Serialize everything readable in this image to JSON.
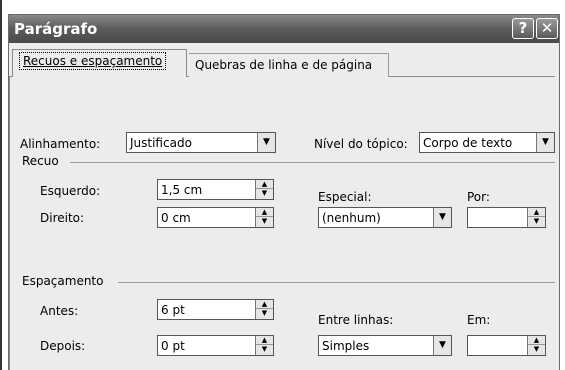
{
  "window": {
    "title": "Parágrafo",
    "help_glyph": "?",
    "close_glyph": "✕"
  },
  "tabs": [
    {
      "label": "Recuos e espaçamento",
      "active": true
    },
    {
      "label": "Quebras de linha e de página",
      "active": false
    }
  ],
  "general": {
    "alignment_label": "Alinhamento:",
    "alignment_value": "Justificado",
    "outline_label": "Nível do tópico:",
    "outline_value": "Corpo de texto"
  },
  "indent": {
    "section_label": "Recuo",
    "left_label": "Esquerdo:",
    "left_value": "1,5 cm",
    "right_label": "Direito:",
    "right_value": "0 cm",
    "special_label": "Especial:",
    "special_value": "(nenhum)",
    "by_label": "Por:",
    "by_value": ""
  },
  "spacing": {
    "section_label": "Espaçamento",
    "before_label": "Antes:",
    "before_value": "6 pt",
    "after_label": "Depois:",
    "after_value": "0 pt",
    "line_label": "Entre linhas:",
    "line_value": "Simples",
    "at_label": "Em:",
    "at_value": ""
  },
  "icons": {
    "dropdown": "▼",
    "spin_up": "▲",
    "spin_down": "▼"
  }
}
